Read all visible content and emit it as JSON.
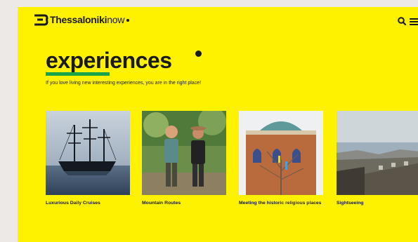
{
  "header": {
    "logo_bold": "Thessaloniki",
    "logo_light": "now",
    "search_icon": "search-icon",
    "menu_icon": "menu-icon"
  },
  "hero": {
    "title": "experiences",
    "subtitle": "If you love living new interesting experiences, you are in the right place!"
  },
  "cards": [
    {
      "label": "Luxurious Daily Cruises",
      "icon": "ship-photo"
    },
    {
      "label": "Mountain Routes",
      "icon": "hikers-photo"
    },
    {
      "label": "Meeting the historic religious places",
      "icon": "church-photo"
    },
    {
      "label": "Sightseeing",
      "icon": "city-view-photo"
    }
  ],
  "colors": {
    "background": "#fff200",
    "accent": "#16a34a",
    "text": "#1a1a1a"
  }
}
